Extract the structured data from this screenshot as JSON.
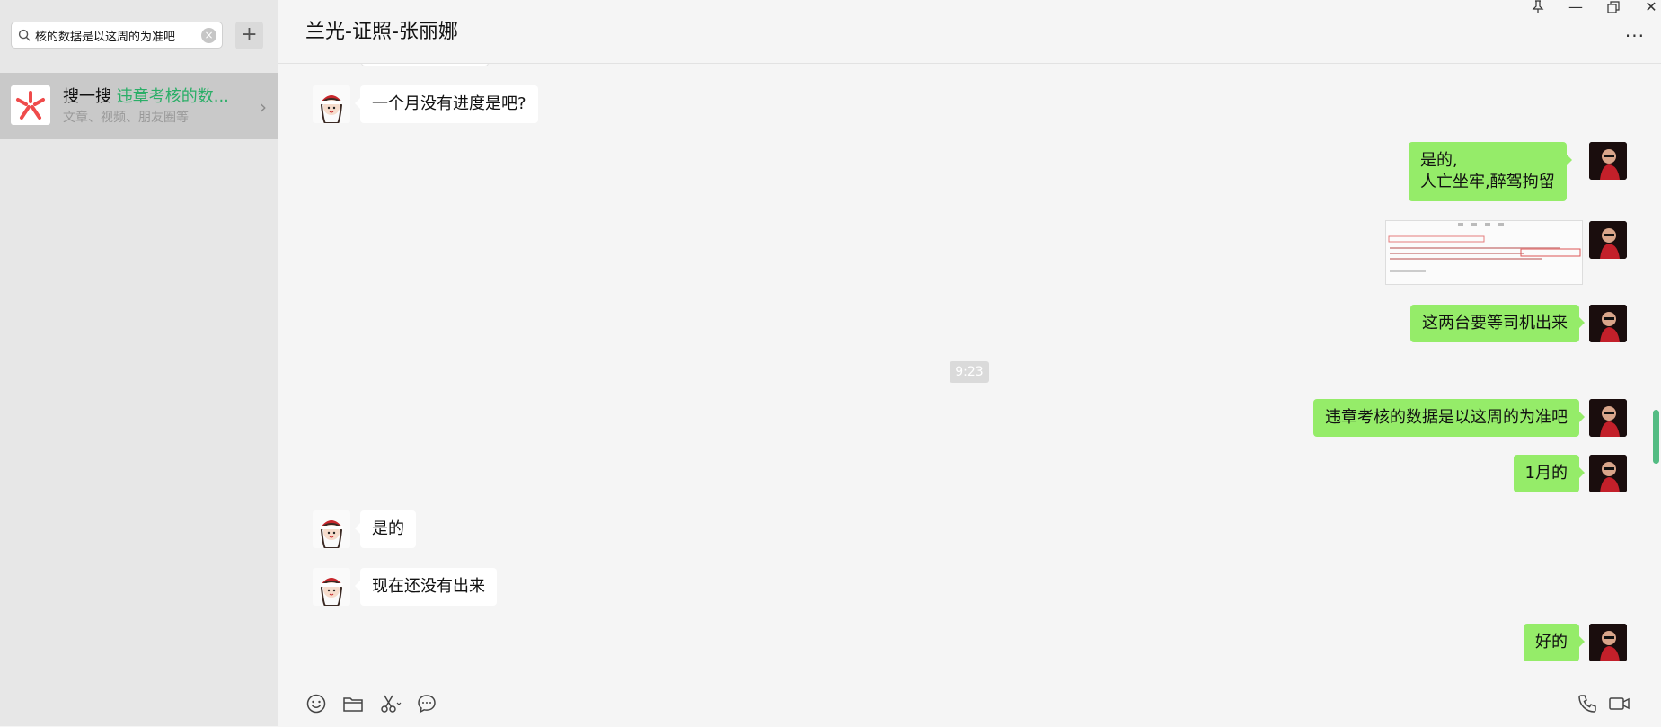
{
  "search": {
    "value": "核的数据是以这周的为准吧",
    "clear_label": "×"
  },
  "add_button": {
    "label": "+"
  },
  "search_result": {
    "title_prefix": "搜一搜",
    "title_highlight": "违章考核的数...",
    "subtitle": "文章、视频、朋友圈等",
    "arrow": "›"
  },
  "chat": {
    "title": "兰光-证照-张丽娜",
    "more_label": "···",
    "window_controls": {
      "pin": "⊥",
      "minimize": "—",
      "restore": "❐",
      "close": "✕"
    }
  },
  "messages": [
    {
      "sender": "them",
      "text": "一个月没有进度是吧?"
    },
    {
      "sender": "me",
      "lines": [
        "是的,",
        "人亡坐牢,醉驾拘留"
      ]
    },
    {
      "sender": "me",
      "type": "image"
    },
    {
      "sender": "me",
      "text": "这两台要等司机出来"
    },
    {
      "type": "time",
      "text": "9:23"
    },
    {
      "sender": "me",
      "text": "违章考核的数据是以这周的为准吧"
    },
    {
      "sender": "me",
      "text": "1月的"
    },
    {
      "sender": "them",
      "text": "是的"
    },
    {
      "sender": "them",
      "text": "现在还没有出来"
    },
    {
      "sender": "me",
      "text": "好的"
    }
  ],
  "toolbar": {
    "icons": [
      "emoji-icon",
      "folder-icon",
      "scissors-icon",
      "chat-history-icon",
      "phone-icon",
      "video-icon"
    ]
  },
  "colors": {
    "accent": "#2aae67",
    "my_bubble": "#95ec69",
    "their_bubble": "#ffffff",
    "sidebar": "#e7e7e7",
    "background": "#f5f5f5"
  }
}
